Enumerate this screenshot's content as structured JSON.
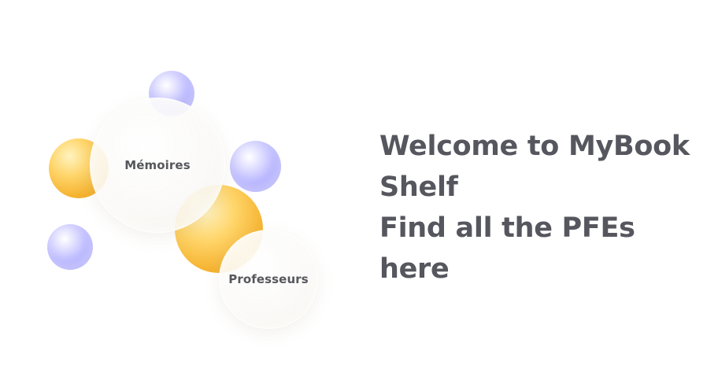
{
  "hero": {
    "bubbles": {
      "memoires_label": "Mémoires",
      "professeurs_label": "Professeurs"
    },
    "colors": {
      "purple_sphere": "#b9b6ff",
      "orange_sphere": "#f5b330",
      "text": "#56565e"
    }
  },
  "welcome": {
    "line1": "Welcome to MyBook",
    "line2": "Shelf",
    "line3": "Find all the PFEs",
    "line4": "here"
  }
}
